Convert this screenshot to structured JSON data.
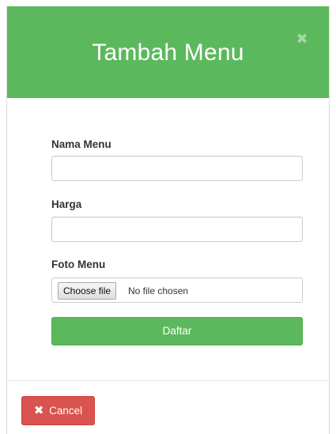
{
  "modal": {
    "title": "Tambah Menu",
    "close_icon": "times-icon"
  },
  "form": {
    "nama_menu_label": "Nama Menu",
    "nama_menu_value": "",
    "harga_label": "Harga",
    "harga_value": "",
    "foto_menu_label": "Foto Menu",
    "choose_file_label": "Choose file",
    "file_status": "No file chosen",
    "submit_label": "Daftar"
  },
  "footer": {
    "cancel_label": "Cancel",
    "cancel_icon": "times-icon"
  },
  "colors": {
    "header": "#5cb85c",
    "submit": "#5cb85c",
    "cancel": "#d9534f"
  }
}
